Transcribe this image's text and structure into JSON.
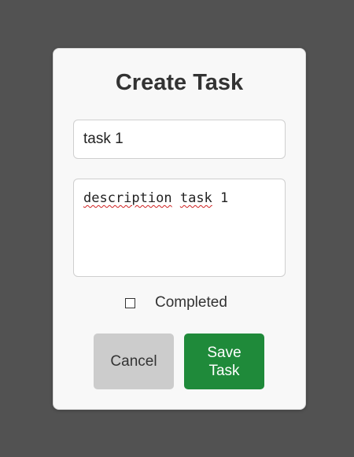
{
  "dialog": {
    "title": "Create Task",
    "name_value": "task 1",
    "description": {
      "word1": "description",
      "space1": " ",
      "word2": "task",
      "space2": " ",
      "word3": "1"
    },
    "completed_label": "Completed",
    "completed_checked": false,
    "cancel_label": "Cancel",
    "save_label": "Save Task"
  },
  "colors": {
    "backdrop": "#525252",
    "dialog_bg": "#f8f8f8",
    "save_button": "#1f8a3a",
    "cancel_button": "#cccccc",
    "spellcheck_underline": "#d02020"
  }
}
